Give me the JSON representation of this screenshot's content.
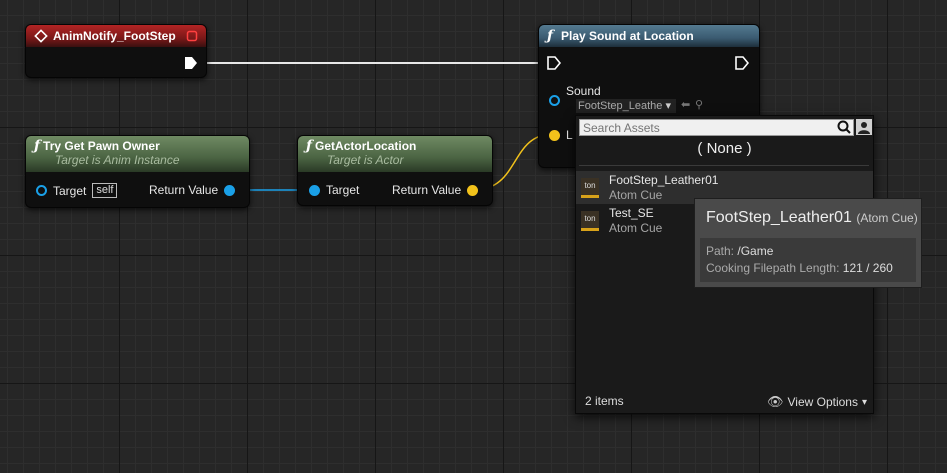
{
  "nodes": {
    "anim_notify": {
      "title": "AnimNotify_FootStep"
    },
    "try_get_pawn": {
      "title": "Try Get Pawn Owner",
      "subtitle": "Target is Anim Instance",
      "target_label": "Target",
      "self_label": "self",
      "return_label": "Return Value"
    },
    "get_actor_location": {
      "title": "GetActorLocation",
      "subtitle": "Target is Actor",
      "target_label": "Target",
      "return_label": "Return Value"
    },
    "play_sound": {
      "title": "Play Sound at Location",
      "sound_label": "Sound",
      "sound_value": "FootStep_Leathe",
      "location_label": "L"
    }
  },
  "picker": {
    "search_placeholder": "Search Assets",
    "none_label": "( None )",
    "items": [
      {
        "name": "FootStep_Leather01",
        "type": "Atom Cue",
        "thumb": "ton"
      },
      {
        "name": "Test_SE",
        "type": "Atom Cue",
        "thumb": "ton"
      }
    ],
    "count": "2 items",
    "view_options": "View Options"
  },
  "tooltip": {
    "title": "FootStep_Leather01",
    "title_type": "(Atom Cue)",
    "path_label": "Path:",
    "path_value": "/Game",
    "cooking_label": "Cooking Filepath Length:",
    "cooking_value": "121 / 260"
  },
  "colors": {
    "event_header": "#a82020",
    "pure_header": "#5d7852",
    "function_header": "#4b6e85",
    "object_pin": "#1aa0e8",
    "vector_pin": "#f2c21b"
  }
}
